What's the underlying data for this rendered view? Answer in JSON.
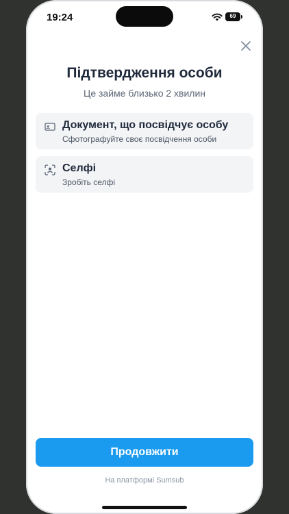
{
  "status_bar": {
    "time": "19:24",
    "battery_level": "69"
  },
  "header": {
    "title": "Підтвердження особи",
    "subtitle": "Це займе близько 2 хвилин"
  },
  "steps": [
    {
      "title": "Документ, що посвідчує особу",
      "description": "Сфотографуйте своє посвідчення особи",
      "icon": "id-card-icon"
    },
    {
      "title": "Селфі",
      "description": "Зробіть селфі",
      "icon": "face-scan-icon"
    }
  ],
  "actions": {
    "continue_label": "Продовжити"
  },
  "footer": {
    "powered_by": "На платформі Sumsub"
  },
  "colors": {
    "accent": "#1a9bf0",
    "step_bg": "#f3f4f6",
    "title": "#1f2a3c"
  }
}
